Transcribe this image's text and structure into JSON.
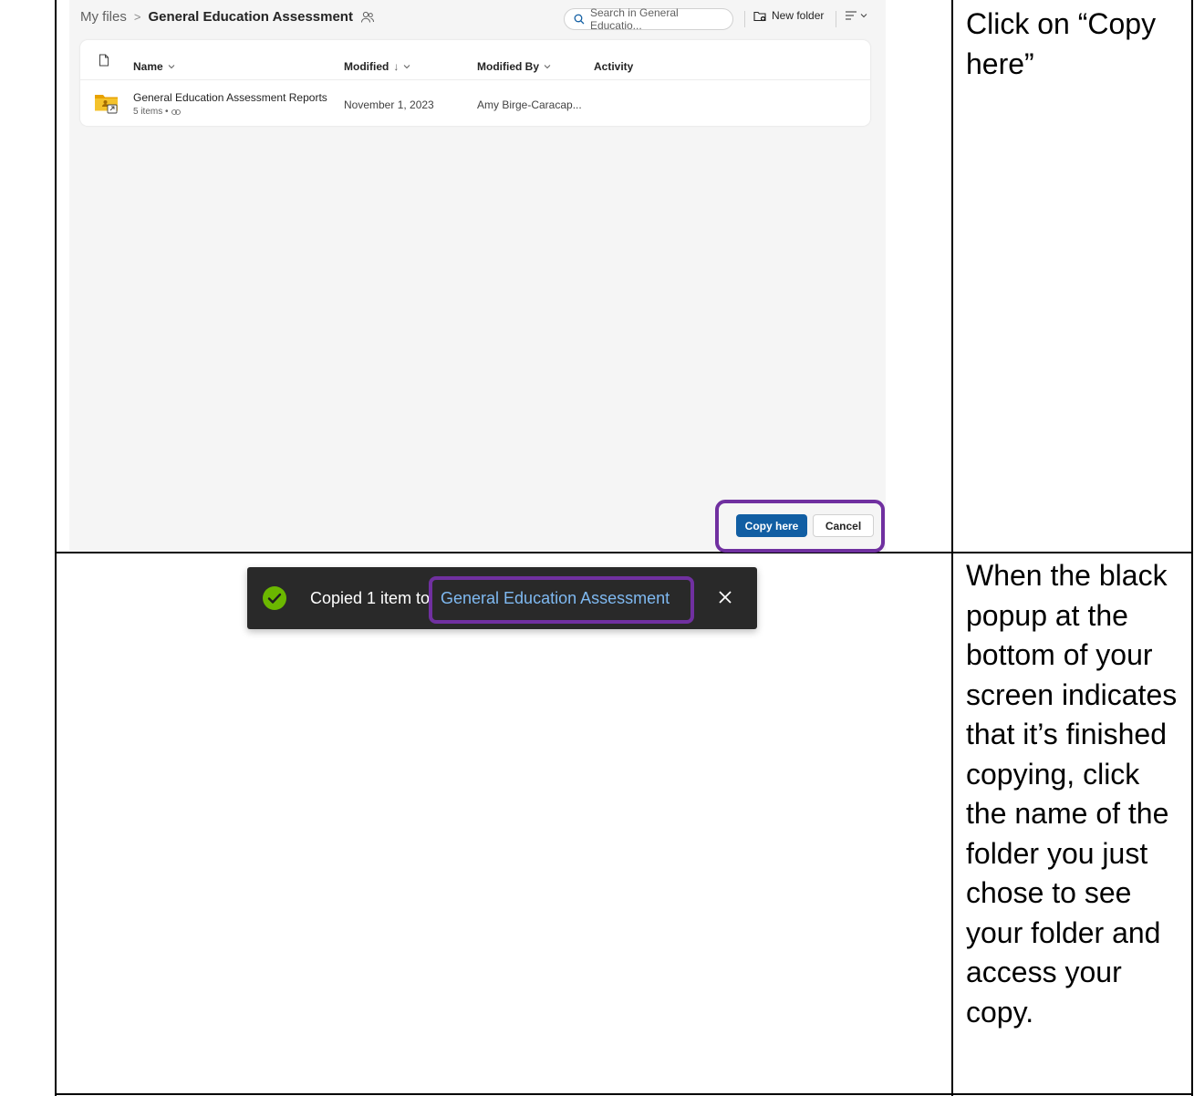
{
  "shot1": {
    "breadcrumb": {
      "root": "My files",
      "separator": ">",
      "current": "General Education Assessment"
    },
    "search": {
      "placeholder": "Search in General Educatio..."
    },
    "toolbar": {
      "new_folder": "New folder"
    },
    "columns": {
      "name": "Name",
      "modified": "Modified",
      "modified_sort": "↓",
      "modified_by": "Modified By",
      "activity": "Activity"
    },
    "rows": [
      {
        "name": "General Education Assessment Reports",
        "meta": "5 items •",
        "modified": "November 1, 2023",
        "modified_by": "Amy Birge-Caracap..."
      }
    ],
    "buttons": {
      "copy_here": "Copy here",
      "cancel": "Cancel"
    },
    "colors": {
      "primary": "#115ea3",
      "highlight": "#7030a0",
      "folder": "#f4c22b"
    }
  },
  "toast": {
    "message": "Copied 1 item to",
    "link": "General Education Assessment",
    "colors": {
      "background": "#292929",
      "link": "#7fb9f1",
      "success": "#6bb700"
    }
  },
  "instructions": [
    "Click on “Copy here”",
    "When the black popup at the bottom of your screen indicates that it’s finished copying, click the name of the folder you just chose to see your folder and access your copy."
  ]
}
